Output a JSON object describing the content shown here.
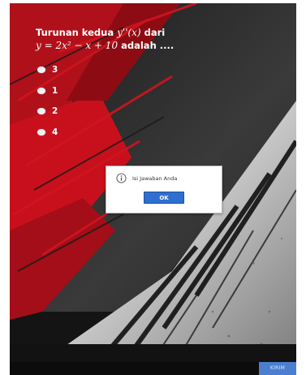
{
  "question": {
    "line1_text": "Turunan kedua",
    "line1_math": "y''(x)",
    "line1_suffix": "dari",
    "line2_math": "y = 2x² − x + 10",
    "line2_suffix": "adalah ...."
  },
  "options": [
    {
      "label": "3"
    },
    {
      "label": "1"
    },
    {
      "label": "2"
    },
    {
      "label": "4"
    }
  ],
  "dialog": {
    "icon": "info-icon",
    "message": "Isi Jawaban Anda",
    "ok_label": "OK"
  },
  "footer": {
    "submit_label": "KIRIM"
  },
  "colors": {
    "accent_red": "#c8101c",
    "background_dark": "#0b0b0b",
    "submit_blue": "#4a7fd0",
    "ok_blue": "#2f6fd0"
  }
}
